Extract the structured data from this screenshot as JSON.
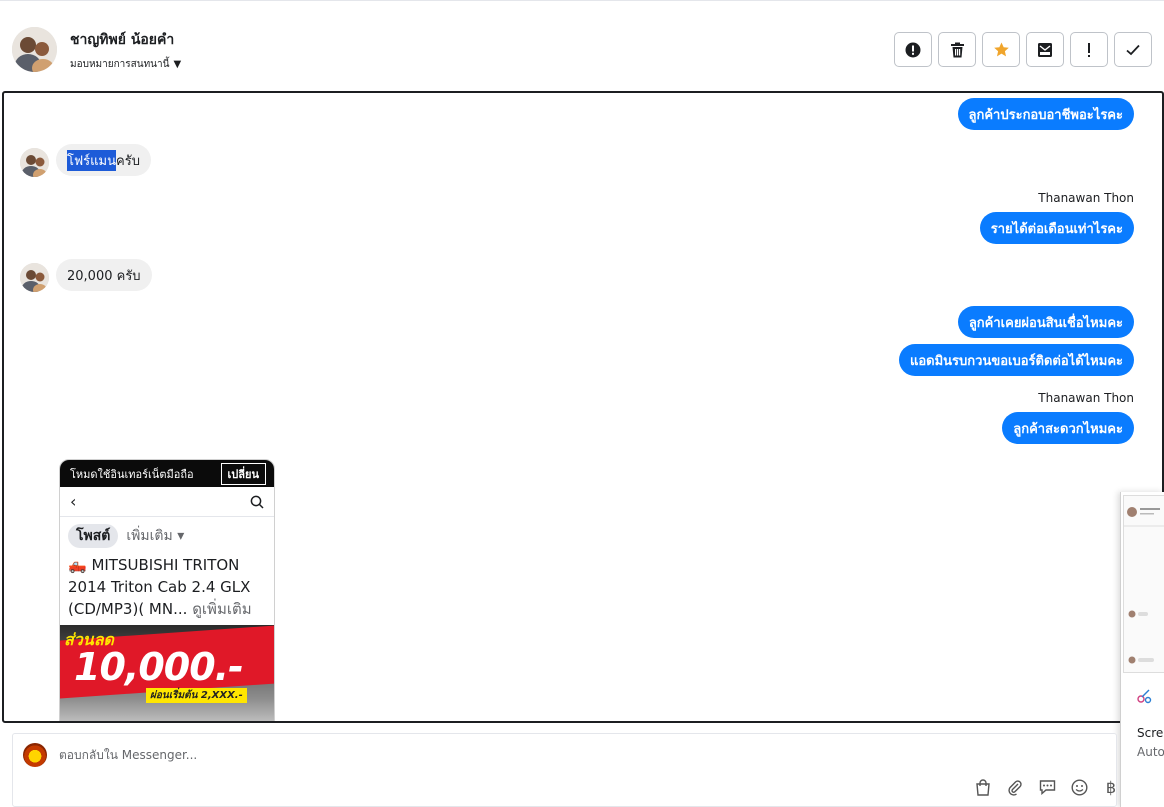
{
  "header": {
    "name": "ชาญทิพย์ น้อยคำ",
    "assign_label": "มอบหมายการสนทนานี้"
  },
  "toolbar": {
    "buttons": [
      {
        "icon": "alert-circle-icon"
      },
      {
        "icon": "trash-icon"
      },
      {
        "icon": "star-icon",
        "color": "#f0a52c"
      },
      {
        "icon": "mark-unread-icon"
      },
      {
        "icon": "exclamation-icon"
      },
      {
        "icon": "check-icon"
      }
    ]
  },
  "messages": {
    "m1": "ลูกค้าประกอบอาชีพอะไรคะ",
    "m2_highlight": "โฟร์แมน",
    "m2_rest": "ครับ",
    "sender1": "Thanawan Thon",
    "m3": "รายได้ต่อเดือนเท่าไรคะ",
    "m4": "20,000 ครับ",
    "m5": "ลูกค้าเคยผ่อนสินเชื่อไหมคะ",
    "m6": "แอดมินรบกวนขอเบอร์ติดต่อได้ไหมคะ",
    "sender2": "Thanawan Thon",
    "m7": "ลูกค้าสะดวกไหมคะ"
  },
  "card": {
    "banner_text": "โหมดใช้อินเทอร์เน็ตมือถือ",
    "banner_button": "เปลี่ยน",
    "tab_posts": "โพสต์",
    "tab_more": "เพิ่มเติม",
    "title_line1": "🛻 MITSUBISHI TRITON",
    "title_line2": "2014 Triton Cab 2.4 GLX",
    "title_line3": "(CD/MP3)( MN...",
    "see_more": "ดูเพิ่มเติม",
    "promo_small": "ส่วนลด",
    "promo_big": "10,000.-",
    "promo_sub": "ผ่อนเริ่มต้น 2,XXX.-"
  },
  "side_preview": {
    "line1": "Scre",
    "line2": "Auto"
  },
  "composer": {
    "placeholder": "ตอบกลับใน Messenger...",
    "tools": [
      "shopping-bag-icon",
      "attachment-icon",
      "saved-reply-icon",
      "emoji-icon",
      "baht-icon"
    ]
  },
  "colors": {
    "bubble_out": "#0a7cff",
    "bubble_in": "#f0f0f0",
    "star": "#f0a52c"
  }
}
